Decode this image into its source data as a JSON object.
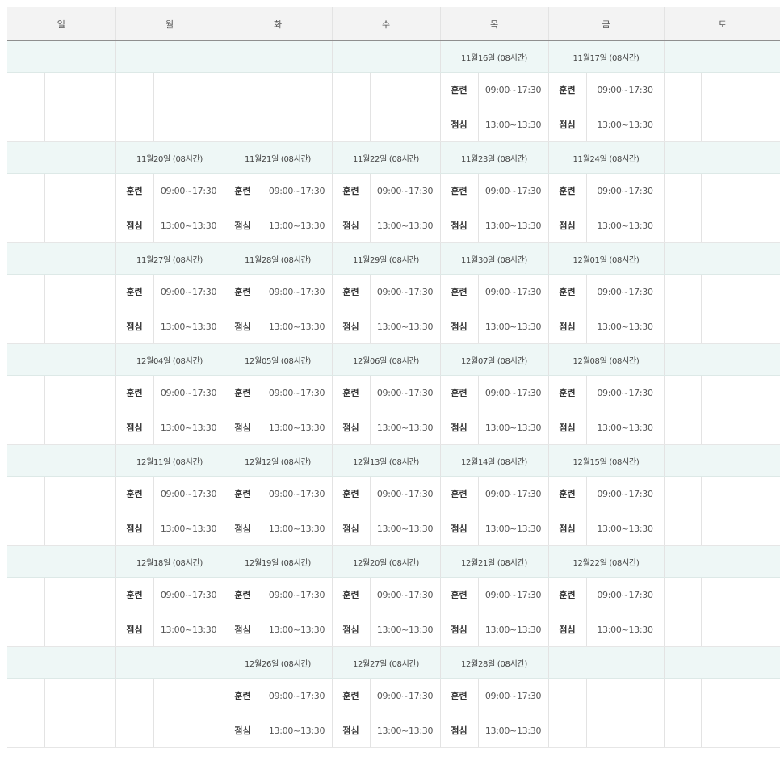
{
  "days": [
    "일",
    "월",
    "화",
    "수",
    "목",
    "금",
    "토"
  ],
  "labels": {
    "training": "훈련",
    "lunch": "점심"
  },
  "times": {
    "training": "09:00~17:30",
    "lunch": "13:00~13:30"
  },
  "weeks": [
    {
      "dates": [
        "",
        "",
        "",
        "",
        "11월16일 (08시간)",
        "11월17일 (08시간)",
        ""
      ]
    },
    {
      "dates": [
        "",
        "11월20일 (08시간)",
        "11월21일 (08시간)",
        "11월22일 (08시간)",
        "11월23일 (08시간)",
        "11월24일 (08시간)",
        ""
      ]
    },
    {
      "dates": [
        "",
        "11월27일 (08시간)",
        "11월28일 (08시간)",
        "11월29일 (08시간)",
        "11월30일 (08시간)",
        "12월01일 (08시간)",
        ""
      ]
    },
    {
      "dates": [
        "",
        "12월04일 (08시간)",
        "12월05일 (08시간)",
        "12월06일 (08시간)",
        "12월07일 (08시간)",
        "12월08일 (08시간)",
        ""
      ]
    },
    {
      "dates": [
        "",
        "12월11일 (08시간)",
        "12월12일 (08시간)",
        "12월13일 (08시간)",
        "12월14일 (08시간)",
        "12월15일 (08시간)",
        ""
      ]
    },
    {
      "dates": [
        "",
        "12월18일 (08시간)",
        "12월19일 (08시간)",
        "12월20일 (08시간)",
        "12월21일 (08시간)",
        "12월22일 (08시간)",
        ""
      ]
    },
    {
      "dates": [
        "",
        "",
        "12월26일 (08시간)",
        "12월27일 (08시간)",
        "12월28일 (08시간)",
        "",
        ""
      ]
    }
  ]
}
